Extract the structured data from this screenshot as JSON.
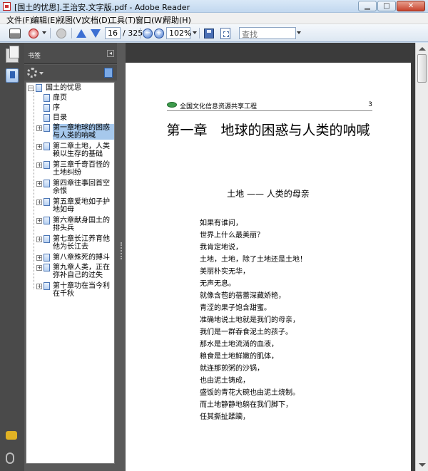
{
  "window": {
    "title": "[国土的忧思].王治安.文字版.pdf - Adobe Reader"
  },
  "menu": [
    "文件(F)",
    "编辑(E)",
    "视图(V)",
    "文档(D)",
    "工具(T)",
    "窗口(W)",
    "帮助(H)"
  ],
  "toolbar": {
    "page_current": "16",
    "page_total": "/ 325",
    "zoom": "102%",
    "find_placeholder": "查找"
  },
  "panel": {
    "title": "书签"
  },
  "bookmarks": [
    {
      "label": "国土的忧思",
      "level": 0,
      "expanded": true
    },
    {
      "label": "扉页",
      "level": 1
    },
    {
      "label": "序",
      "level": 1
    },
    {
      "label": "目录",
      "level": 1
    },
    {
      "label": "第一章地球的困惑与人类的呐喊",
      "level": 1,
      "expandable": true,
      "selected": true
    },
    {
      "label": "第二章土地，人类赖以生存的基础",
      "level": 1,
      "expandable": true
    },
    {
      "label": "第三章千奇百怪的土地纠纷",
      "level": 1,
      "expandable": true
    },
    {
      "label": "第四章往事回首空余恨",
      "level": 1,
      "expandable": true
    },
    {
      "label": "第五章爱地如子护地如母",
      "level": 1,
      "expandable": true
    },
    {
      "label": "第六章献身国土的排头兵",
      "level": 1,
      "expandable": true
    },
    {
      "label": "第七章长江养育他他为长江去",
      "level": 1,
      "expandable": true
    },
    {
      "label": "第八章殊死的搏斗",
      "level": 1,
      "expandable": true
    },
    {
      "label": "第九章人类，正在弥补自己的过失",
      "level": 1,
      "expandable": true
    },
    {
      "label": "第十章功在当今利在千秋",
      "level": 1,
      "expandable": true
    }
  ],
  "document": {
    "header": "全国文化信息资源共享工程",
    "page_number": "3",
    "chapter_title": "第一章　地球的困惑与人类的呐喊",
    "section_title": "土地 —— 人类的母亲",
    "lines": [
      "如果有谁问，",
      "世界上什么最美丽？",
      "我肯定地说，",
      "土地，土地，除了土地还是土地！",
      "美丽朴实无华，",
      "无声无息。",
      "就像含苞的蓓蕾深藏娇艳，",
      "青涩的果子饱含甜蜜。",
      "准确地说土地就是我们的母亲，",
      "我们是一群吞食泥土的孩子。",
      "那水是土地流淌的血液，",
      "粮食是土地鲜嫩的肌体，",
      "就连那煎粥的沙锅，",
      "也由泥土铸成，",
      "盛饭的青花大碗也由泥土烧制。",
      "而土地静静地躺在我们脚下，",
      "任其撕扯蹂躏，"
    ]
  }
}
